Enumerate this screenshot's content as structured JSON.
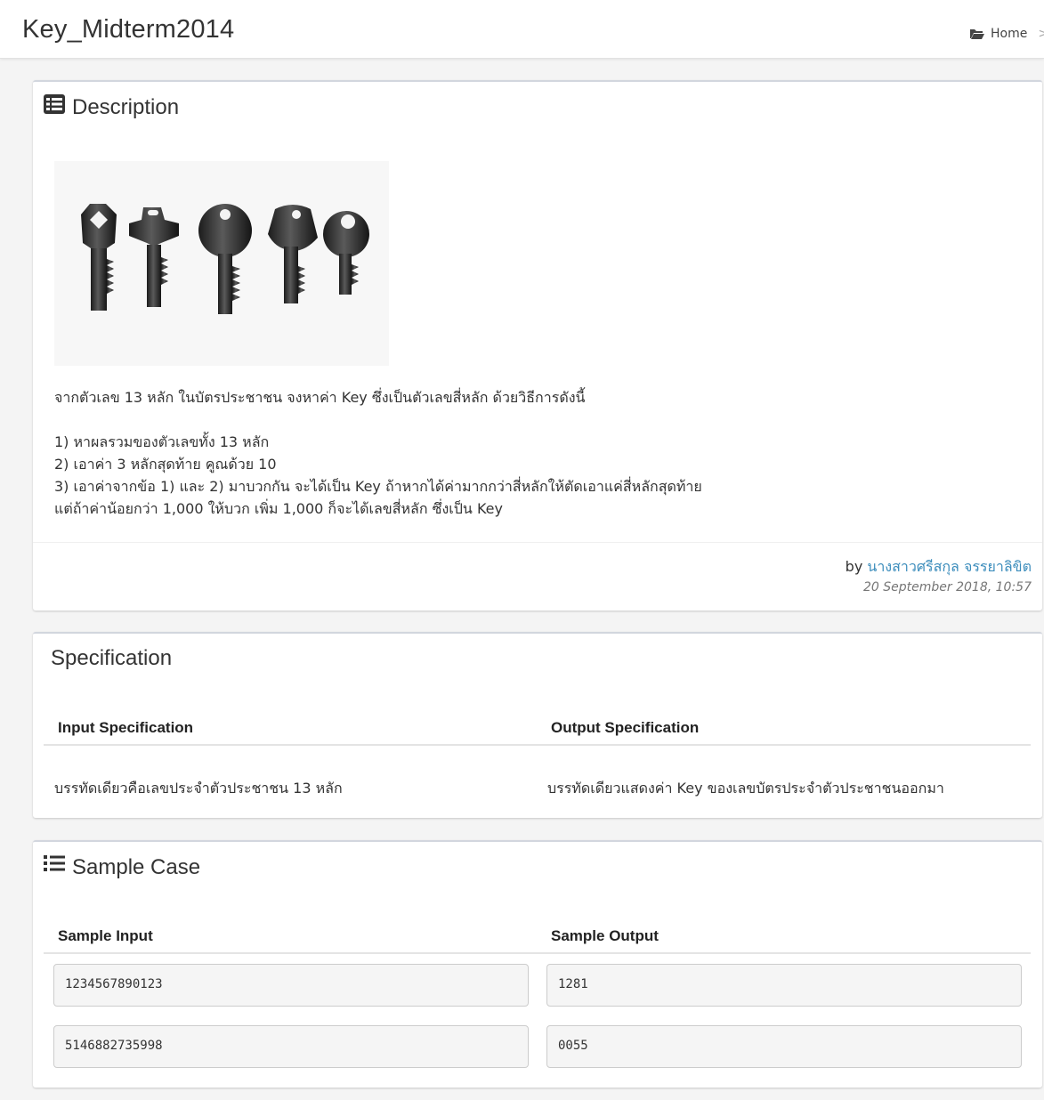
{
  "header": {
    "page_title": "Key_Midterm2014",
    "breadcrumb_home": "Home",
    "breadcrumb_sep": ">"
  },
  "description": {
    "title": "Description",
    "image_alt": "keys",
    "lines": [
      "จากตัวเลข 13 หลัก ในบัตรประชาชน จงหาค่า Key ซึ่งเป็นตัวเลขสี่หลัก ด้วยวิธีการดังนี้",
      "1) หาผลรวมของตัวเลขทั้ง 13 หลัก",
      "2) เอาค่า 3 หลักสุดท้าย คูณด้วย 10",
      "3) เอาค่าจากข้อ 1) และ 2) มาบวกกัน จะได้เป็น Key ถ้าหากได้ค่ามากกว่าสี่หลักให้ตัดเอาแค่สี่หลักสุดท้าย",
      "แต่ถ้าค่าน้อยกว่า 1,000 ให้บวก เพิ่ม 1,000 ก็จะได้เลขสี่หลัก ซึ่งเป็น Key"
    ],
    "by_label": "by",
    "author": "นางสาวศรีสกุล จรรยาลิขิต",
    "date": "20 September 2018, 10:57"
  },
  "specification": {
    "title": "Specification",
    "input_header": "Input Specification",
    "output_header": "Output Specification",
    "input_text": "บรรทัดเดียวคือเลขประจำตัวประชาชน 13 หลัก",
    "output_text": "บรรทัดเดียวแสดงค่า Key ของเลขบัตรประจำตัวประชาชนออกมา"
  },
  "sample": {
    "title": "Sample Case",
    "input_header": "Sample Input",
    "output_header": "Sample Output",
    "cases": [
      {
        "input": "1234567890123",
        "output": "1281"
      },
      {
        "input": "5146882735998",
        "output": "0055"
      }
    ]
  },
  "colors": {
    "link": "#3c8dbc",
    "panel_border": "#d2d6de",
    "code_bg": "#f5f5f5"
  }
}
